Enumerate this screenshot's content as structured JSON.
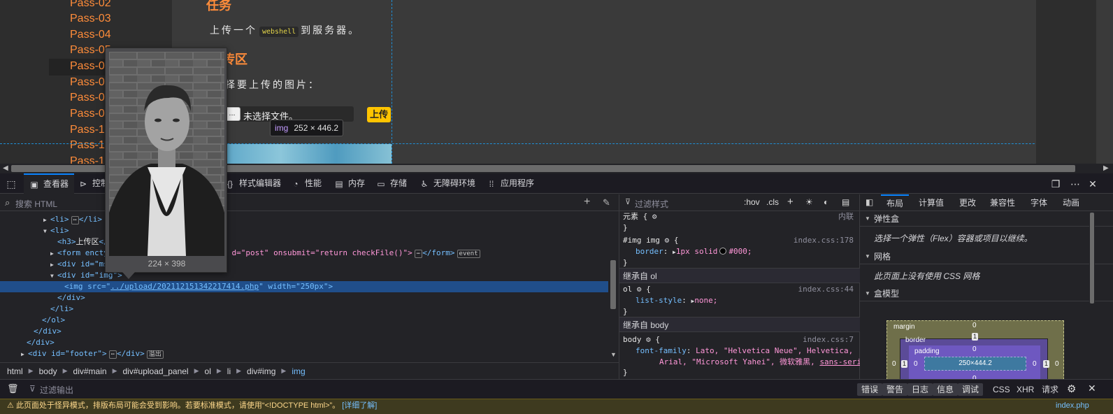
{
  "page": {
    "sidebar_items": [
      "Pass-02",
      "Pass-03",
      "Pass-04",
      "Pass-05",
      "Pass-06",
      "Pass-07",
      "Pass-08",
      "Pass-09",
      "Pass-10",
      "Pass-11",
      "Pass-12"
    ],
    "task_title": "任务",
    "task_text_pre": "上传一个",
    "task_code": "webshell",
    "task_text_post": "到服务器。",
    "upload_title_fragment": "传区",
    "choose_text": "择要上传的图片：",
    "file_button": "...",
    "file_label": "未选择文件。",
    "upload_button": "上传",
    "size_tip_tag": "img",
    "size_tip_dims": "252 × 446.2"
  },
  "preview": {
    "dims": "224 × 398"
  },
  "devtools": {
    "tabs": {
      "inspector": "查看器",
      "console": "控制",
      "style_editor": "样式编辑器",
      "performance": "性能",
      "memory": "内存",
      "storage": "存储",
      "accessibility": "无障碍环境",
      "application": "应用程序"
    },
    "html_search_placeholder": "搜索 HTML",
    "tree": {
      "l1": "<li>",
      "l1_close": "</li>",
      "l2": "<li>",
      "l3_open": "<h3>",
      "l3_text": "上传区",
      "l3_close": "</h",
      "l4_tag": "<form enctyp",
      "l4_attrs_tail": "d=\"post\" onsubmit=\"return checkFile()\">",
      "l4_close": "</form>",
      "l4_badge": "event",
      "l5": "<div id=\"msg",
      "l6": "<div id=\"img\">",
      "sel_pre": "<img src=\"",
      "sel_link": "../upload/202112151342217414.php",
      "sel_post": "\" width=\"250px\">",
      "c1": "</div>",
      "c2": "</li>",
      "c3": "</ol>",
      "c4": "</div>",
      "c5": "</div>",
      "footer_tag": "<div id=\"footer\">",
      "footer_close": "</div>",
      "footer_badge": "溢出"
    },
    "breadcrumbs": [
      "html",
      "body",
      "div#main",
      "div#upload_panel",
      "ol",
      "li",
      "div#img",
      "img"
    ],
    "rules": {
      "filter_placeholder": "过滤样式",
      "hov": ":hov",
      "cls": ".cls",
      "element_label": "元素 {",
      "element_src": "内联",
      "element_close": "}",
      "r1_selector": "#img img",
      "r1_src": "index.css:178",
      "r1_prop": "border",
      "r1_val_a": "1px solid",
      "r1_val_b": "#000;",
      "inherit_ol": "继承自 ol",
      "r2_selector": "ol",
      "r2_src": "index.css:44",
      "r2_prop": "list-style",
      "r2_val": "none;",
      "inherit_body": "继承自 body",
      "r3_selector": "body",
      "r3_src": "index.css:7",
      "r3_prop": "font-family",
      "r3_val_1": "Lato, \"Helvetica Neue\", Helvetica,",
      "r3_val_2a": "Arial, \"Microsoft Yahei\", 微软雅黑,",
      "r3_val_2b": "sans-serif",
      "r3_val_2c": ";"
    },
    "layout": {
      "tabs": [
        "布局",
        "计算值",
        "更改",
        "兼容性",
        "字体",
        "动画"
      ],
      "flex_title": "弹性盒",
      "flex_note": "选择一个弹性（Flex）容器或项目以继续。",
      "grid_title": "网格",
      "grid_note": "此页面上没有使用 CSS 网格",
      "box_title": "盒模型",
      "margin_label": "margin",
      "border_label": "border",
      "padding_label": "padding",
      "content_size": "250×444.2",
      "m_top": "0",
      "m_left": "0",
      "m_right": "0",
      "b_top": "1",
      "b_left": "1",
      "b_right": "1",
      "p_top": "0",
      "p_left": "0",
      "p_right": "0",
      "p_bottom": "0"
    },
    "console": {
      "filter_placeholder": "过滤输出",
      "buttons": [
        "错误",
        "警告",
        "日志",
        "信息",
        "调试"
      ],
      "plain": [
        "CSS",
        "XHR",
        "请求"
      ]
    },
    "warning": {
      "text": "此页面处于怪异模式，排版布局可能会受到影响。若要标准模式，请使用“<!DOCTYPE html>”。",
      "link": "[详细了解]",
      "source": "index.php"
    }
  }
}
